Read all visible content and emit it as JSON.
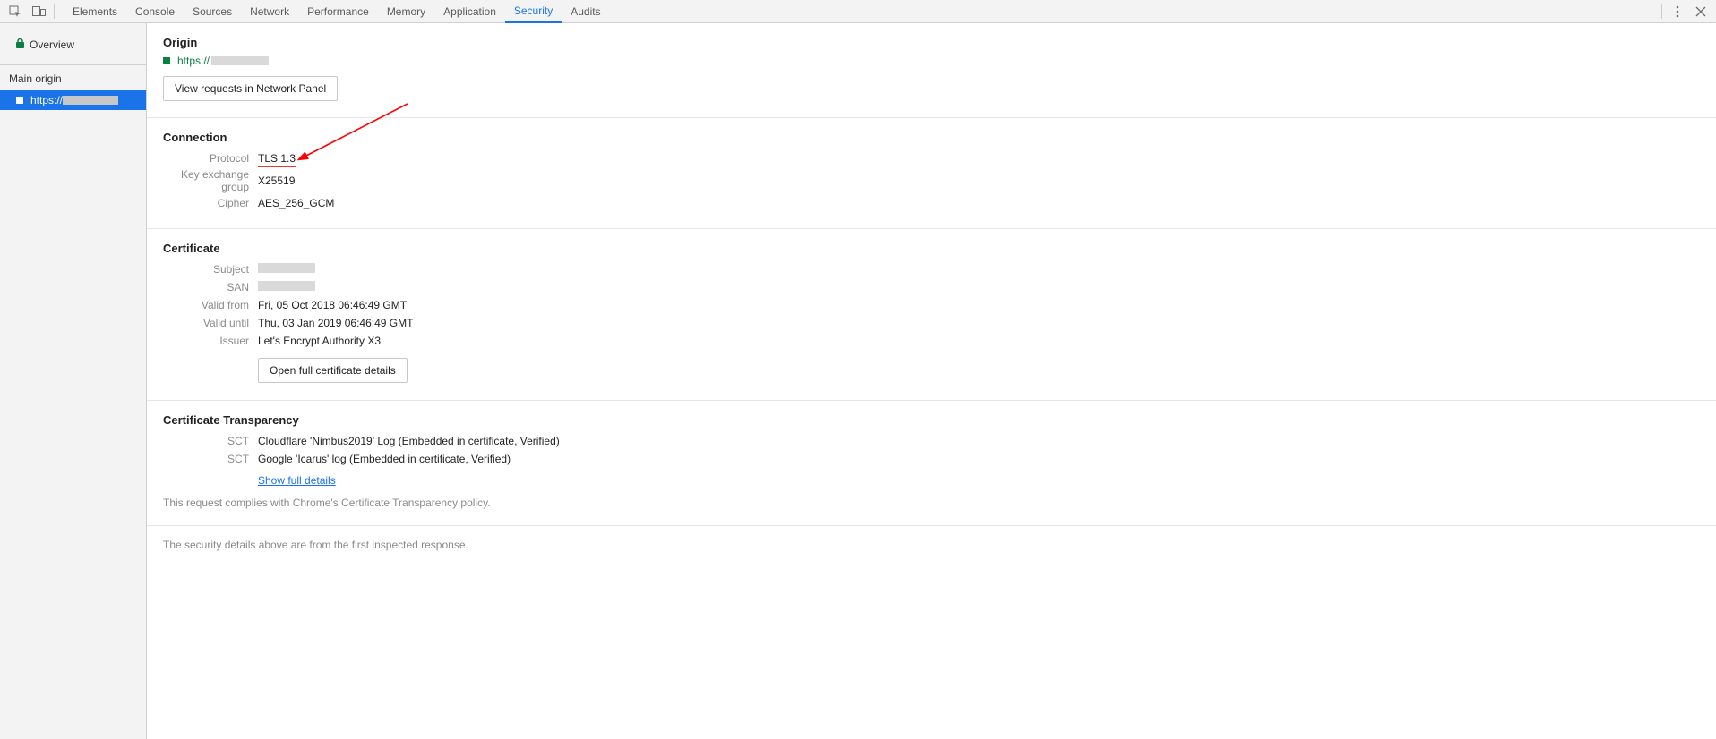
{
  "toolbar": {
    "tabs": [
      "Elements",
      "Console",
      "Sources",
      "Network",
      "Performance",
      "Memory",
      "Application",
      "Security",
      "Audits"
    ],
    "active_tab": "Security"
  },
  "sidebar": {
    "overview_label": "Overview",
    "main_origin_label": "Main origin",
    "origin_prefix": "https://"
  },
  "origin": {
    "heading": "Origin",
    "url_prefix": "https://",
    "button_label": "View requests in Network Panel"
  },
  "connection": {
    "heading": "Connection",
    "rows": {
      "protocol_label": "Protocol",
      "protocol_value": "TLS 1.3",
      "kex_label": "Key exchange group",
      "kex_value": "X25519",
      "cipher_label": "Cipher",
      "cipher_value": "AES_256_GCM"
    }
  },
  "certificate": {
    "heading": "Certificate",
    "rows": {
      "subject_label": "Subject",
      "san_label": "SAN",
      "valid_from_label": "Valid from",
      "valid_from_value": "Fri, 05 Oct 2018 06:46:49 GMT",
      "valid_until_label": "Valid until",
      "valid_until_value": "Thu, 03 Jan 2019 06:46:49 GMT",
      "issuer_label": "Issuer",
      "issuer_value": "Let's Encrypt Authority X3"
    },
    "button_label": "Open full certificate details"
  },
  "ct": {
    "heading": "Certificate Transparency",
    "sct_label": "SCT",
    "sct1": "Cloudflare 'Nimbus2019' Log (Embedded in certificate, Verified)",
    "sct2": "Google 'Icarus' log (Embedded in certificate, Verified)",
    "show_full": "Show full details",
    "compliance": "This request complies with Chrome's Certificate Transparency policy."
  },
  "footer_note": "The security details above are from the first inspected response."
}
